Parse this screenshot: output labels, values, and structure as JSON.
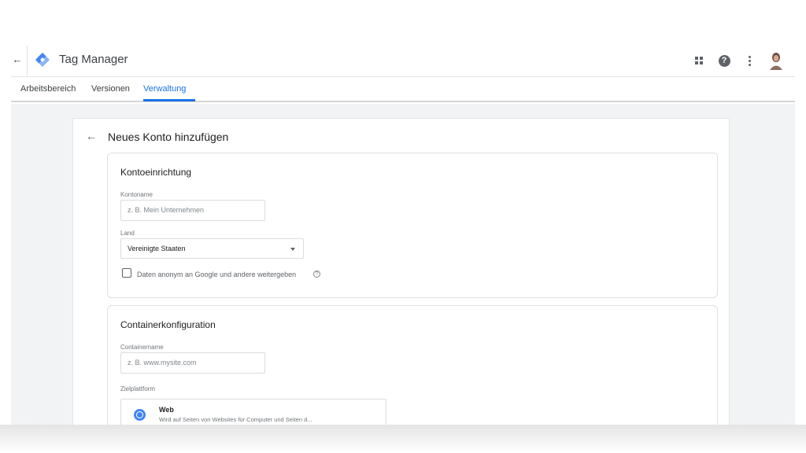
{
  "appbar": {
    "title": "Tag Manager",
    "back_icon": "arrow-left-icon",
    "logo_icon": "tag-manager-logo-icon",
    "icons": [
      "apps-grid-icon",
      "help-icon",
      "more-vert-icon",
      "avatar"
    ]
  },
  "tabs": [
    {
      "label": "Arbeitsbereich",
      "active": false
    },
    {
      "label": "Versionen",
      "active": false
    },
    {
      "label": "Verwaltung",
      "active": true
    }
  ],
  "panel": {
    "title": "Neues Konto hinzufügen",
    "back_icon": "arrow-left-icon"
  },
  "account_setup": {
    "title": "Kontoeinrichtung",
    "account_name_label": "Kontoname",
    "account_name_placeholder": "z. B. Mein Unternehmen",
    "country_label": "Land",
    "country_value": "Vereinigte Staaten",
    "share_label": "Daten anonym an Google und andere weitergeben",
    "share_checked": false
  },
  "container_setup": {
    "title": "Containerkonfiguration",
    "container_name_label": "Containername",
    "container_name_placeholder": "z. B. www.mysite.com",
    "target_platform_label": "Zielplattform",
    "platform": {
      "title": "Web",
      "description": "Wird auf Seiten von Websites für Computer und Seiten d..."
    }
  },
  "colors": {
    "accent": "#1a73e8",
    "background": "#f1f3f4",
    "logo_blue": "#4285f4"
  }
}
